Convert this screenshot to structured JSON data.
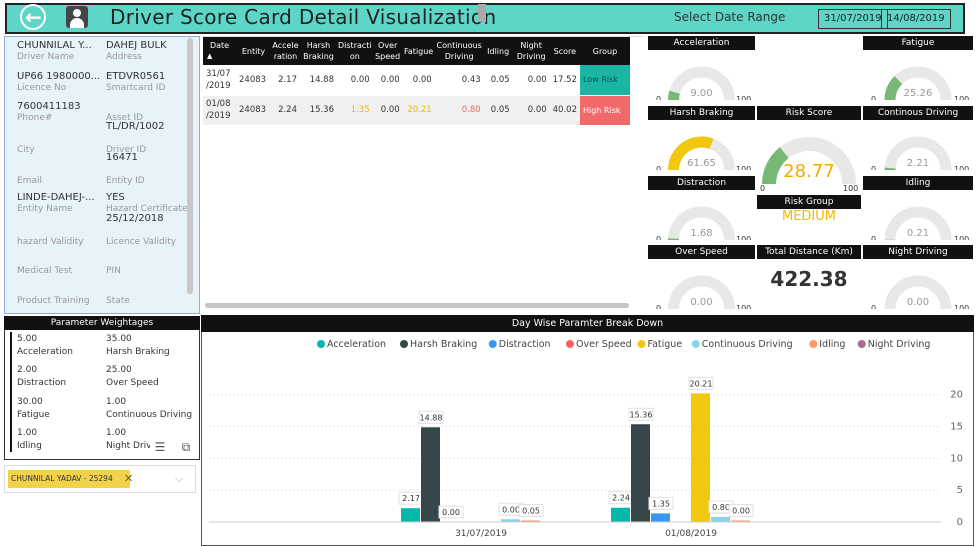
{
  "header": {
    "title": "Driver Score Card Detail Visualization",
    "date_range_label": "Select Date Range",
    "start_date": "31/07/2019",
    "end_date": "14/08/2019"
  },
  "driver": {
    "rows": [
      {
        "l_val": "CHUNNILAL Y...",
        "l_lab": "Driver Name",
        "r_val": "DAHEJ BULK",
        "r_lab": "Address"
      },
      {
        "l_val": "UP66 1980000...",
        "l_lab": "Licence No",
        "r_val": "ETDVR0561",
        "r_lab": "Smartcard ID"
      },
      {
        "l_val": "7600411183",
        "l_lab": "Phone#",
        "r_val": "",
        "r_lab": "Asset ID"
      },
      {
        "l_val": "",
        "l_lab": "City",
        "r_val": "TL/DR/1002",
        "r_lab": "Driver ID"
      },
      {
        "l_val": "",
        "l_lab": "Email",
        "r_val": "16471",
        "r_lab": "Entity ID"
      },
      {
        "l_val": "LINDE-DAHEJ-...",
        "l_lab": "Entity Name",
        "r_val": "YES",
        "r_lab": "Hazard Certificate"
      },
      {
        "l_val": "",
        "l_lab": "hazard Validity",
        "r_val": "25/12/2018",
        "r_lab": "Licence Validity"
      },
      {
        "l_val": "",
        "l_lab": "Medical Test",
        "r_val": "",
        "r_lab": "PIN"
      },
      {
        "l_val": "",
        "l_lab": "Product Training",
        "r_val": "",
        "r_lab": "State"
      }
    ]
  },
  "weightages": {
    "title": "Parameter Weightages",
    "items": [
      {
        "l_val": "5.00",
        "l_lab": "Acceleration",
        "r_val": "35.00",
        "r_lab": "Harsh Braking"
      },
      {
        "l_val": "2.00",
        "l_lab": "Distraction",
        "r_val": "25.00",
        "r_lab": "Over Speed"
      },
      {
        "l_val": "30.00",
        "l_lab": "Fatigue",
        "r_val": "1.00",
        "r_lab": "Continuous Driving"
      },
      {
        "l_val": "1.00",
        "l_lab": "Idling",
        "r_val": "1.00",
        "r_lab": "Night Driv"
      }
    ]
  },
  "slicer": {
    "selected": "CHUNNILAL YADAV - 25294",
    "clear": "✕",
    "chevron": "⌵"
  },
  "table": {
    "headers": [
      "Date",
      "Entity",
      "Accele ration",
      "Harsh Braking",
      "Distracti on",
      "Over Speed",
      "Fatigue",
      "Continuous Driving",
      "Idling",
      "Night Driving",
      "Score",
      "Group"
    ],
    "rows": [
      {
        "date": "31/07 /2019",
        "entity": "24083",
        "acc": "2.17",
        "hb": "14.88",
        "dis": "0.00",
        "os": "0.00",
        "fat": "0.00",
        "cd": "0.43",
        "idl": "0.05",
        "nd": "0.00",
        "score": "17.52",
        "group": "Low Risk"
      },
      {
        "date": "01/08 /2019",
        "entity": "24083",
        "acc": "2.24",
        "hb": "15.36",
        "dis": "1.35",
        "os": "0.00",
        "fat": "20.21",
        "cd": "0.80",
        "idl": "0.05",
        "nd": "0.00",
        "score": "40.02",
        "group": "High Risk"
      }
    ],
    "sort_indicator": "▲"
  },
  "gauges": {
    "acceleration": {
      "title": "Acceleration",
      "value": "9.00",
      "min": "0",
      "max": "100",
      "fraction": 0.09
    },
    "fatigue": {
      "title": "Fatigue",
      "value": "25.26",
      "min": "0",
      "max": "100",
      "fraction": 0.2526
    },
    "harsh_braking": {
      "title": "Harsh Braking",
      "value": "61.65",
      "min": "0",
      "max": "100",
      "fraction": 0.6165
    },
    "continous_driving": {
      "title": "Continous Driving",
      "value": "2.21",
      "min": "0",
      "max": "100",
      "fraction": 0.0221
    },
    "distraction": {
      "title": "Distraction",
      "value": "1.68",
      "min": "0",
      "max": "100",
      "fraction": 0.0168
    },
    "idling": {
      "title": "Idling",
      "value": "0.21",
      "min": "0",
      "max": "100",
      "fraction": 0.0021
    },
    "over_speed": {
      "title": "Over Speed",
      "value": "0.00",
      "min": "0",
      "max": "100",
      "fraction": 0
    },
    "night_driving": {
      "title": "Night Driving",
      "value": "0.00",
      "min": "0",
      "max": "100",
      "fraction": 0
    },
    "risk_score": {
      "title": "Risk Score",
      "value": "28.77",
      "min": "0",
      "max": "100",
      "fraction": 0.2877
    }
  },
  "risk_group": {
    "title": "Risk Group",
    "value": "MEDIUM"
  },
  "total_distance": {
    "title": "Total Distance (Km)",
    "value": "422.38"
  },
  "colors": {
    "accent": "#5dd6c7",
    "low_risk": "#1ab5a5",
    "high_risk": "#f06a6a",
    "orange_text": "#f5b800",
    "red_text": "#f06a6a",
    "gauge_green": "#77b877",
    "gauge_yellow": "#f2c80f"
  },
  "chart_data": {
    "type": "bar",
    "title": "Day Wise Paramter Break Down",
    "categories": [
      "31/07/2019",
      "01/08/2019"
    ],
    "series": [
      {
        "name": "Acceleration",
        "color": "#01b8aa",
        "values": [
          2.17,
          2.24
        ]
      },
      {
        "name": "Harsh Braking",
        "color": "#374649",
        "values": [
          14.88,
          15.36
        ]
      },
      {
        "name": "Distraction",
        "color": "#3599f3",
        "values": [
          0.0,
          1.35
        ]
      },
      {
        "name": "Over Speed",
        "color": "#fd625e",
        "values": [
          0,
          0
        ]
      },
      {
        "name": "Fatigue",
        "color": "#f2c80f",
        "values": [
          0.0,
          20.21
        ]
      },
      {
        "name": "Continuous Driving",
        "color": "#8ad4eb",
        "values": [
          0.43,
          0.8
        ]
      },
      {
        "name": "Idling",
        "color": "#fe9666",
        "values": [
          0.05,
          0.05
        ]
      },
      {
        "name": "Night Driving",
        "color": "#a66999",
        "values": [
          0.0,
          0.0
        ]
      }
    ],
    "bar_labels": [
      [
        "2.17",
        "14.88",
        "0.00",
        "",
        "",
        "0.00",
        "0.05",
        ""
      ],
      [
        "2.24",
        "15.36",
        "1.35",
        "",
        "20.21",
        "0.80",
        "0.00",
        ""
      ]
    ],
    "yticks": [
      0,
      5,
      10,
      15,
      20
    ],
    "ylim": [
      0,
      22
    ],
    "grid": true,
    "legend": "top"
  }
}
